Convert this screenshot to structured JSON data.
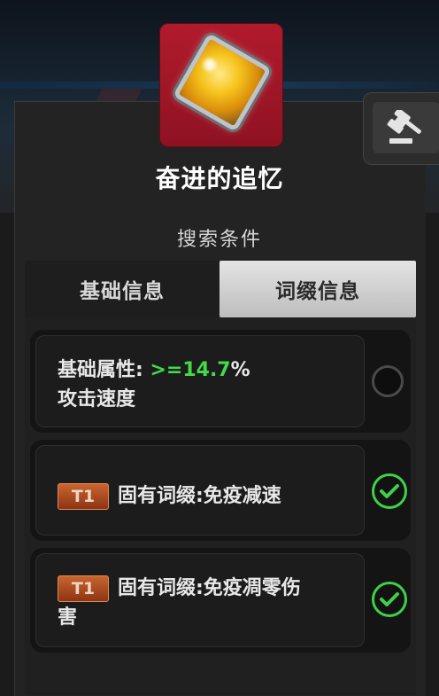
{
  "item": {
    "name": "奋进的追忆",
    "icon": "golden-crystal-icon",
    "rarity_color": "#b11b2c"
  },
  "header": {
    "hammer_icon": "auction-hammer-icon",
    "search_label": "搜索条件"
  },
  "tabs": [
    {
      "label": "基础信息",
      "active": false
    },
    {
      "label": "词缀信息",
      "active": true
    }
  ],
  "conditions": [
    {
      "prefix": "基础属性: ",
      "value": ">=14.7",
      "unit": "%",
      "stat": "攻击速度",
      "selected": false
    },
    {
      "tag": "T1",
      "text": "固有词缀:免疫减速",
      "selected": true
    },
    {
      "tag": "T1",
      "text": "固有词缀:免疫凋零伤害",
      "selected": true
    }
  ],
  "colors": {
    "value_green": "#43d94a",
    "check_green": "#3fd04a",
    "tag_orange": "#c9642f"
  }
}
